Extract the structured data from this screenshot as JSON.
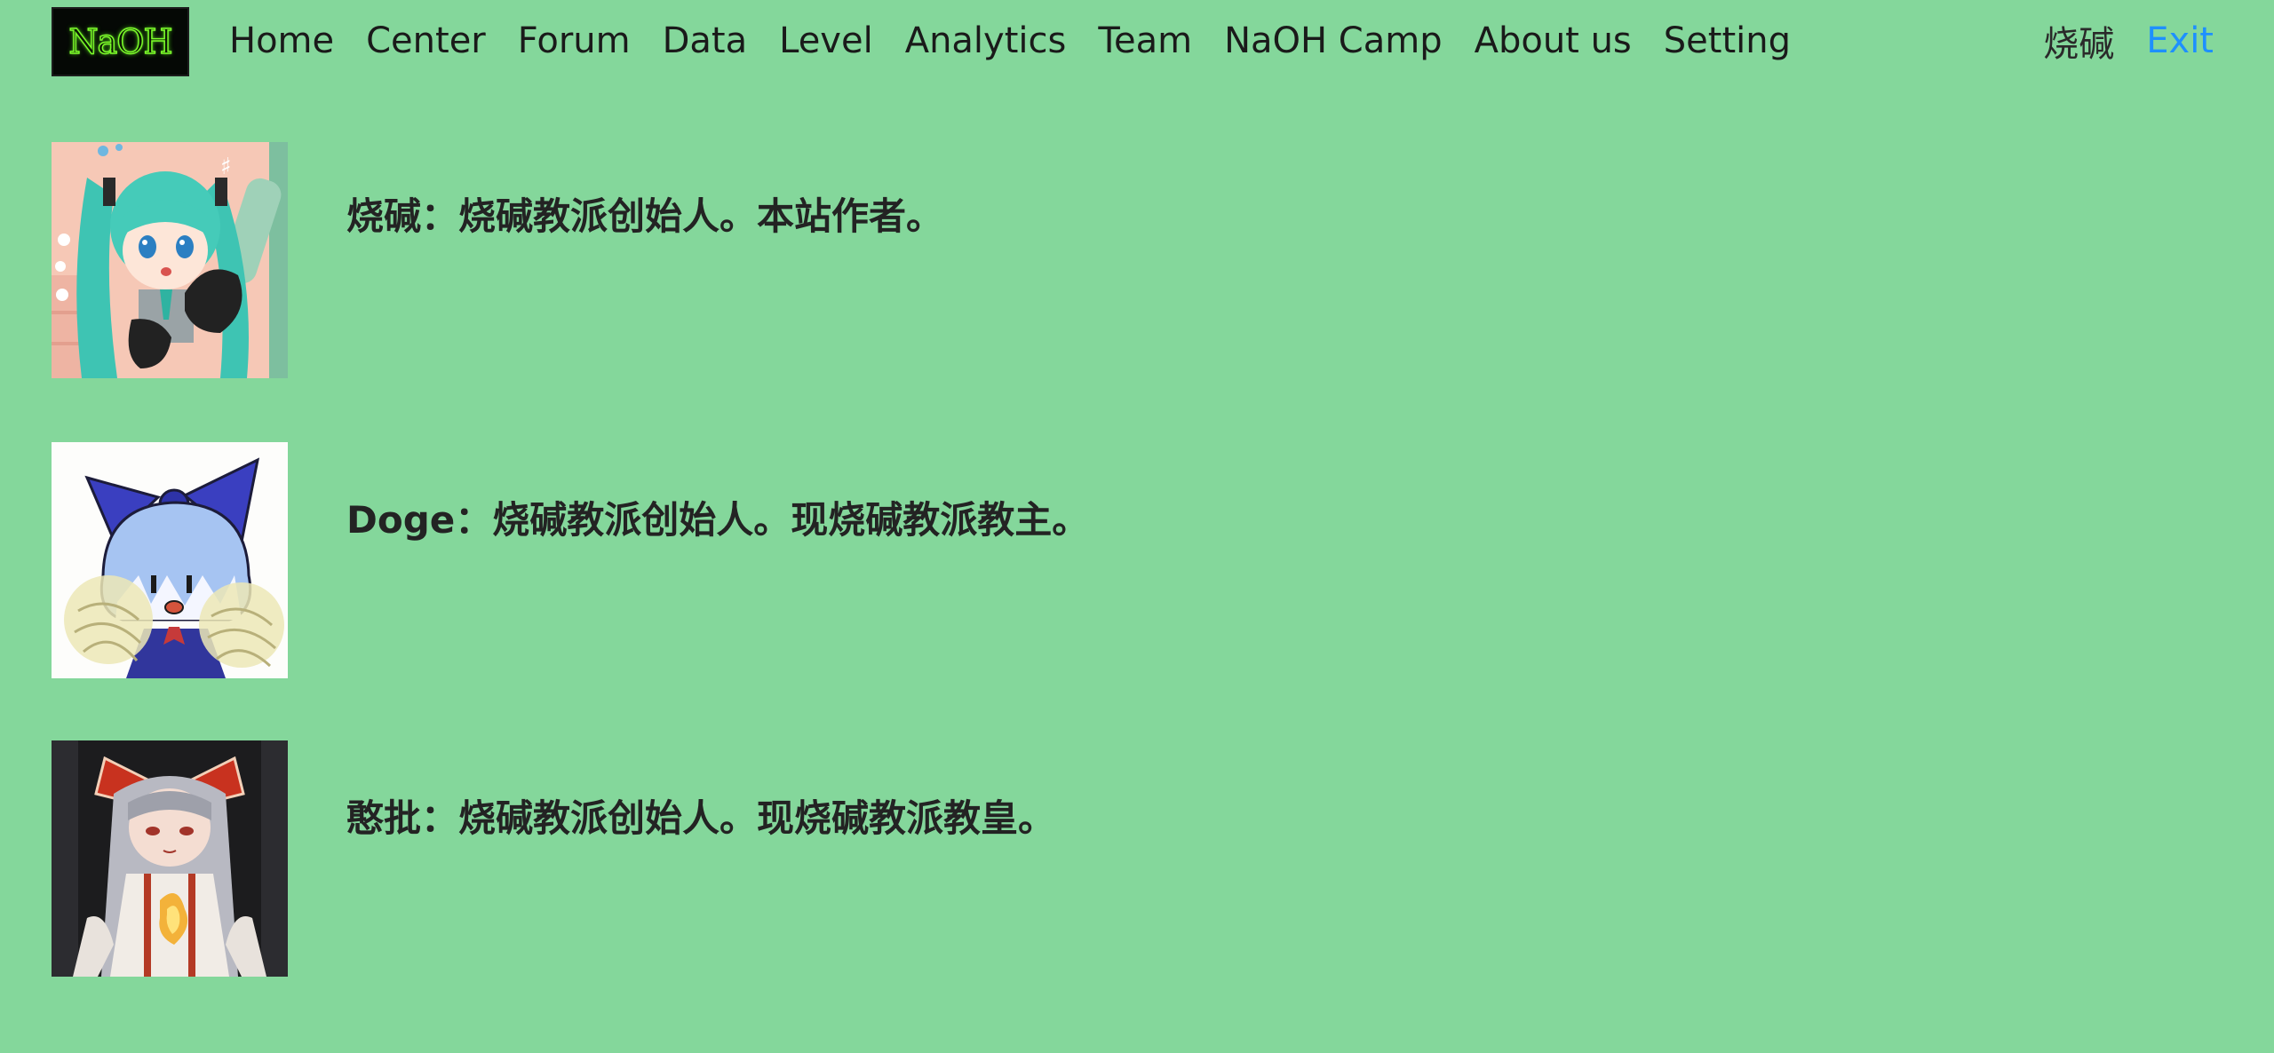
{
  "brand": {
    "logo_text": "NaOH"
  },
  "nav": {
    "items": [
      {
        "label": "Home"
      },
      {
        "label": "Center"
      },
      {
        "label": "Forum"
      },
      {
        "label": "Data"
      },
      {
        "label": "Level"
      },
      {
        "label": "Analytics"
      },
      {
        "label": "Team"
      },
      {
        "label": "NaOH Camp"
      },
      {
        "label": "About us"
      },
      {
        "label": "Setting"
      }
    ]
  },
  "user": {
    "name": "烧碱",
    "exit_label": "Exit"
  },
  "members": [
    {
      "description": "烧碱：烧碱教派创始人。本站作者。"
    },
    {
      "description": "Doge：烧碱教派创始人。现烧碱教派教主。"
    },
    {
      "description": "憨批：烧碱教派创始人。现烧碱教派教皇。"
    }
  ],
  "colors": {
    "page_background": "#84d79b",
    "exit_link": "#1e90ff",
    "logo_background": "#050805",
    "logo_glow": "#7cff2a"
  }
}
